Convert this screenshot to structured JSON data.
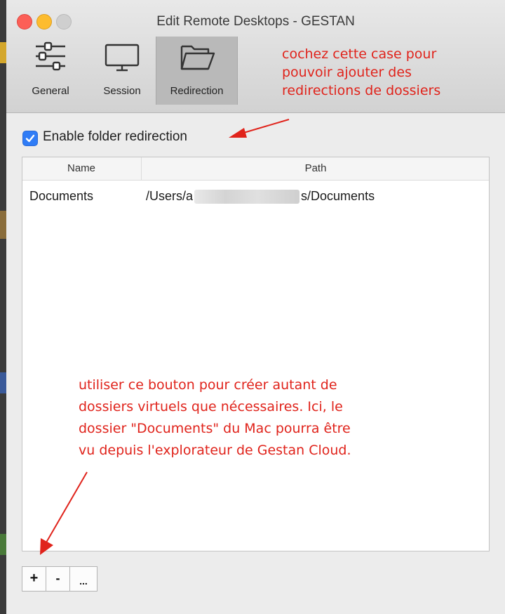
{
  "window": {
    "title": "Edit Remote Desktops - GESTAN"
  },
  "toolbar": {
    "general_label": "General",
    "session_label": "Session",
    "redirection_label": "Redirection"
  },
  "annotations": {
    "top_line1": "cochez cette case pour",
    "top_line2": "pouvoir ajouter des",
    "top_line3": "redirections de dossiers",
    "mid_line1": "utiliser ce bouton pour créer autant de",
    "mid_line2": "dossiers virtuels que nécessaires. Ici, le",
    "mid_line3": "dossier \"Documents\" du Mac pourra être",
    "mid_line4": "vu depuis l'explorateur de Gestan Cloud."
  },
  "checkbox": {
    "label": "Enable folder redirection",
    "checked": true
  },
  "table": {
    "headers": {
      "name": "Name",
      "path": "Path"
    },
    "rows": [
      {
        "name": "Documents",
        "path_start": "/Users/a",
        "path_end": "s/Documents"
      }
    ]
  },
  "buttons": {
    "add": "+",
    "remove": "-",
    "more": "..."
  },
  "colors": {
    "annotation": "#e0231b",
    "checkbox": "#2f7cf6",
    "selected_tool": "#b9b9b9"
  },
  "icons": [
    "general-sliders-icon",
    "session-monitor-icon",
    "redirection-folder-icon",
    "checkmark-icon",
    "annotation-arrow-icon"
  ]
}
